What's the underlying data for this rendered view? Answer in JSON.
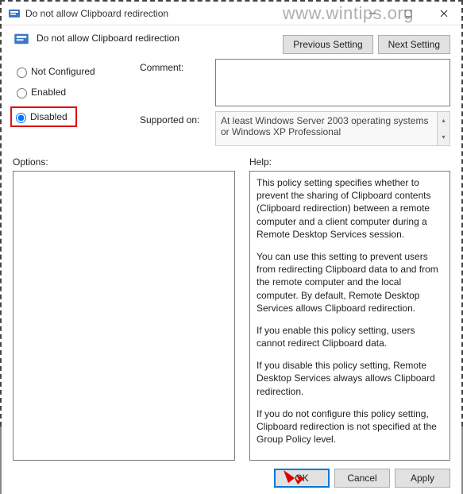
{
  "window": {
    "title": "Do not allow Clipboard redirection",
    "heading": "Do not allow Clipboard redirection"
  },
  "watermark": "www.wintips.org",
  "nav": {
    "previous": "Previous Setting",
    "next": "Next Setting"
  },
  "radios": {
    "not_configured": "Not Configured",
    "enabled": "Enabled",
    "disabled": "Disabled",
    "selected": "disabled"
  },
  "labels": {
    "comment": "Comment:",
    "supported_on": "Supported on:",
    "options": "Options:",
    "help": "Help:"
  },
  "comment": "",
  "supported_on": "At least Windows Server 2003 operating systems or Windows XP Professional",
  "help": {
    "p1": "This policy setting specifies whether to prevent the sharing of Clipboard contents (Clipboard redirection) between a remote computer and a client computer during a Remote Desktop Services session.",
    "p2": "You can use this setting to prevent users from redirecting Clipboard data to and from the remote computer and the local computer. By default, Remote Desktop Services allows Clipboard redirection.",
    "p3": "If you enable this policy setting, users cannot redirect Clipboard data.",
    "p4": "If you disable this policy setting, Remote Desktop Services always allows Clipboard redirection.",
    "p5": "If you do not configure this policy setting, Clipboard redirection is not specified at the Group Policy level."
  },
  "buttons": {
    "ok": "OK",
    "cancel": "Cancel",
    "apply": "Apply"
  }
}
